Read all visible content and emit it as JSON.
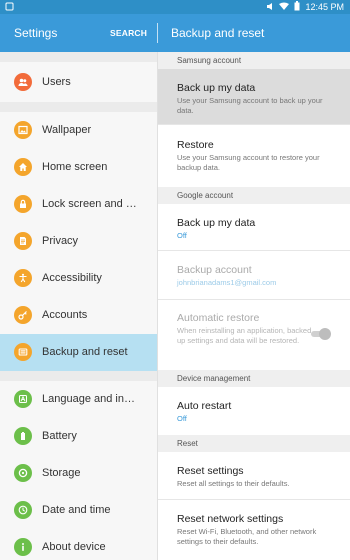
{
  "status_bar": {
    "time": "12:45 PM"
  },
  "app_bar": {
    "left_title": "Settings",
    "search_label": "SEARCH",
    "right_title": "Backup and reset"
  },
  "sidebar": {
    "items": [
      {
        "label": "Users",
        "icon": "users-icon",
        "color": "#f26b3a"
      },
      {
        "label": "Wallpaper",
        "icon": "wallpaper-icon",
        "color": "#f4a52c"
      },
      {
        "label": "Home screen",
        "icon": "home-screen-icon",
        "color": "#f4a52c"
      },
      {
        "label": "Lock screen and s...",
        "icon": "lock-icon",
        "color": "#f4a52c"
      },
      {
        "label": "Privacy",
        "icon": "privacy-icon",
        "color": "#f4a52c"
      },
      {
        "label": "Accessibility",
        "icon": "accessibility-icon",
        "color": "#f4a52c"
      },
      {
        "label": "Accounts",
        "icon": "key-icon",
        "color": "#f4a52c"
      },
      {
        "label": "Backup and reset",
        "icon": "backup-icon",
        "color": "#f4a52c"
      },
      {
        "label": "Language and input",
        "icon": "language-icon",
        "color": "#6cbf4a"
      },
      {
        "label": "Battery",
        "icon": "battery-icon",
        "color": "#6cbf4a"
      },
      {
        "label": "Storage",
        "icon": "storage-icon",
        "color": "#6cbf4a"
      },
      {
        "label": "Date and time",
        "icon": "clock-icon",
        "color": "#6cbf4a"
      },
      {
        "label": "About device",
        "icon": "info-icon",
        "color": "#6cbf4a"
      }
    ],
    "active": "Backup and reset"
  },
  "detail": {
    "sections": {
      "samsung": "Samsung account",
      "google": "Google account",
      "device": "Device management",
      "reset": "Reset"
    },
    "rows": {
      "samsung_backup": {
        "title": "Back up my data",
        "sub": "Use your Samsung account to back up your data."
      },
      "restore": {
        "title": "Restore",
        "sub": "Use your Samsung account to restore your backup data."
      },
      "google_backup": {
        "title": "Back up my data",
        "sub": "Off"
      },
      "backup_account": {
        "title": "Backup account",
        "sub": "johnbrianadams1@gmail.com"
      },
      "auto_restore": {
        "title": "Automatic restore",
        "sub": "When reinstalling an application, backed up settings and data will be restored.",
        "toggle_on": false
      },
      "auto_restart": {
        "title": "Auto restart",
        "sub": "Off"
      },
      "reset_settings": {
        "title": "Reset settings",
        "sub": "Reset all settings to their defaults."
      },
      "reset_network": {
        "title": "Reset network settings",
        "sub": "Reset Wi-Fi, Bluetooth, and other network settings to their defaults."
      }
    }
  }
}
